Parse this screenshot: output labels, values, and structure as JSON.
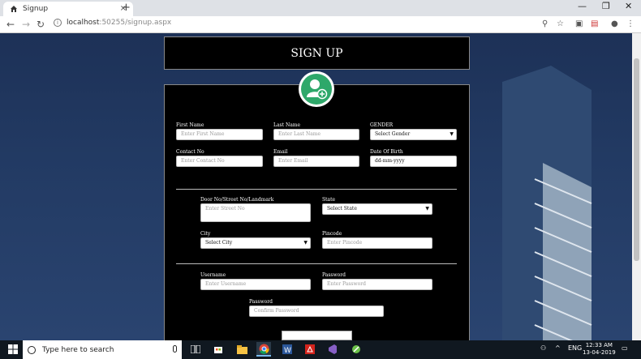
{
  "browser": {
    "tab_title": "Signup",
    "tab_close": "×",
    "new_tab": "+",
    "url_host": "localhost",
    "url_rest": ":50255/signup.aspx",
    "window_controls": [
      "—",
      "❐",
      "✕"
    ]
  },
  "header": {
    "title": "SIGN UP"
  },
  "form": {
    "first_name": {
      "label": "First Name",
      "placeholder": "Enter First Name"
    },
    "last_name": {
      "label": "Last Name",
      "placeholder": "Enter Last Name"
    },
    "gender": {
      "label": "GENDER",
      "value": "Select Gender"
    },
    "contact": {
      "label": "Contact No",
      "placeholder": "Enter Contact No"
    },
    "email": {
      "label": "Email",
      "placeholder": "Enter Email"
    },
    "dob": {
      "label": "Date Of Birth",
      "value": "dd-mm-yyyy"
    },
    "street": {
      "label": "Door No/Street No/Landmark",
      "placeholder": "Enter Street No"
    },
    "state": {
      "label": "State",
      "value": "Select State"
    },
    "city": {
      "label": "City",
      "value": "Select City"
    },
    "pincode": {
      "label": "Pincode",
      "placeholder": "Enter Pincode"
    },
    "username": {
      "label": "Username",
      "placeholder": "Enter Username"
    },
    "password": {
      "label": "Password",
      "placeholder": "Enter Password"
    },
    "confirm": {
      "label": "Password",
      "placeholder": "Confirm Password"
    }
  },
  "taskbar": {
    "search_placeholder": "Type here to search",
    "lang": "ENG",
    "time": "12:33 AM",
    "date": "13-04-2019"
  },
  "colors": {
    "avatar_green": "#2ea86a",
    "form_bg": "#000000",
    "page_bg": "#1d3157"
  }
}
